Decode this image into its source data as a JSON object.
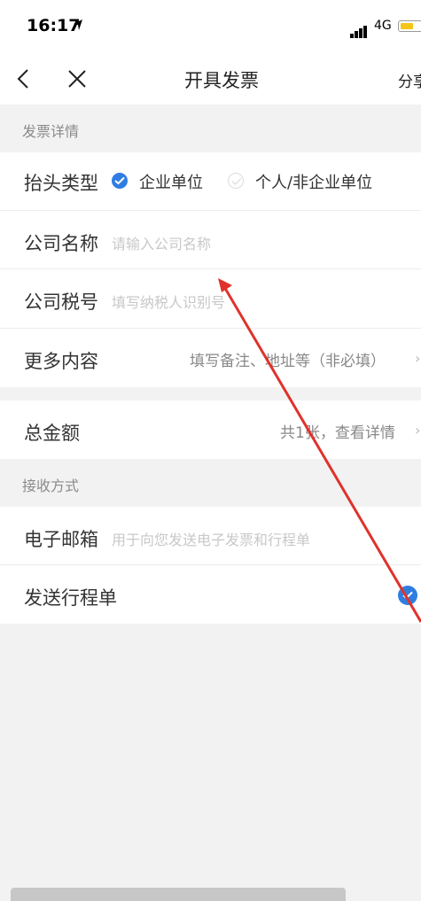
{
  "status": {
    "time": "16:17",
    "network": "4G",
    "location_icon": "location-arrow-icon",
    "battery_color": "#f5c518"
  },
  "nav": {
    "title": "开具发票",
    "share": "分享",
    "back_icon": "chevron-left-icon",
    "close_icon": "close-icon"
  },
  "invoice_section": {
    "label": "发票详情",
    "header_type": {
      "label": "抬头类型",
      "options": [
        {
          "label": "企业单位",
          "selected": true
        },
        {
          "label": "个人/非企业单位",
          "selected": false
        }
      ]
    },
    "company_name": {
      "label": "公司名称",
      "placeholder": "请输入公司名称"
    },
    "tax_id": {
      "label": "公司税号",
      "placeholder": "填写纳税人识别号"
    },
    "more": {
      "label": "更多内容",
      "hint": "填写备注、地址等（非必填）"
    }
  },
  "total": {
    "label": "总金额",
    "hint": "共1张，查看详情"
  },
  "receive_section": {
    "label": "接收方式",
    "email": {
      "label": "电子邮箱",
      "placeholder": "用于向您发送电子发票和行程单"
    },
    "itinerary": {
      "label": "发送行程单",
      "checked": true
    }
  },
  "colors": {
    "accent": "#2f7de1",
    "annotation_arrow": "#e0322a"
  }
}
